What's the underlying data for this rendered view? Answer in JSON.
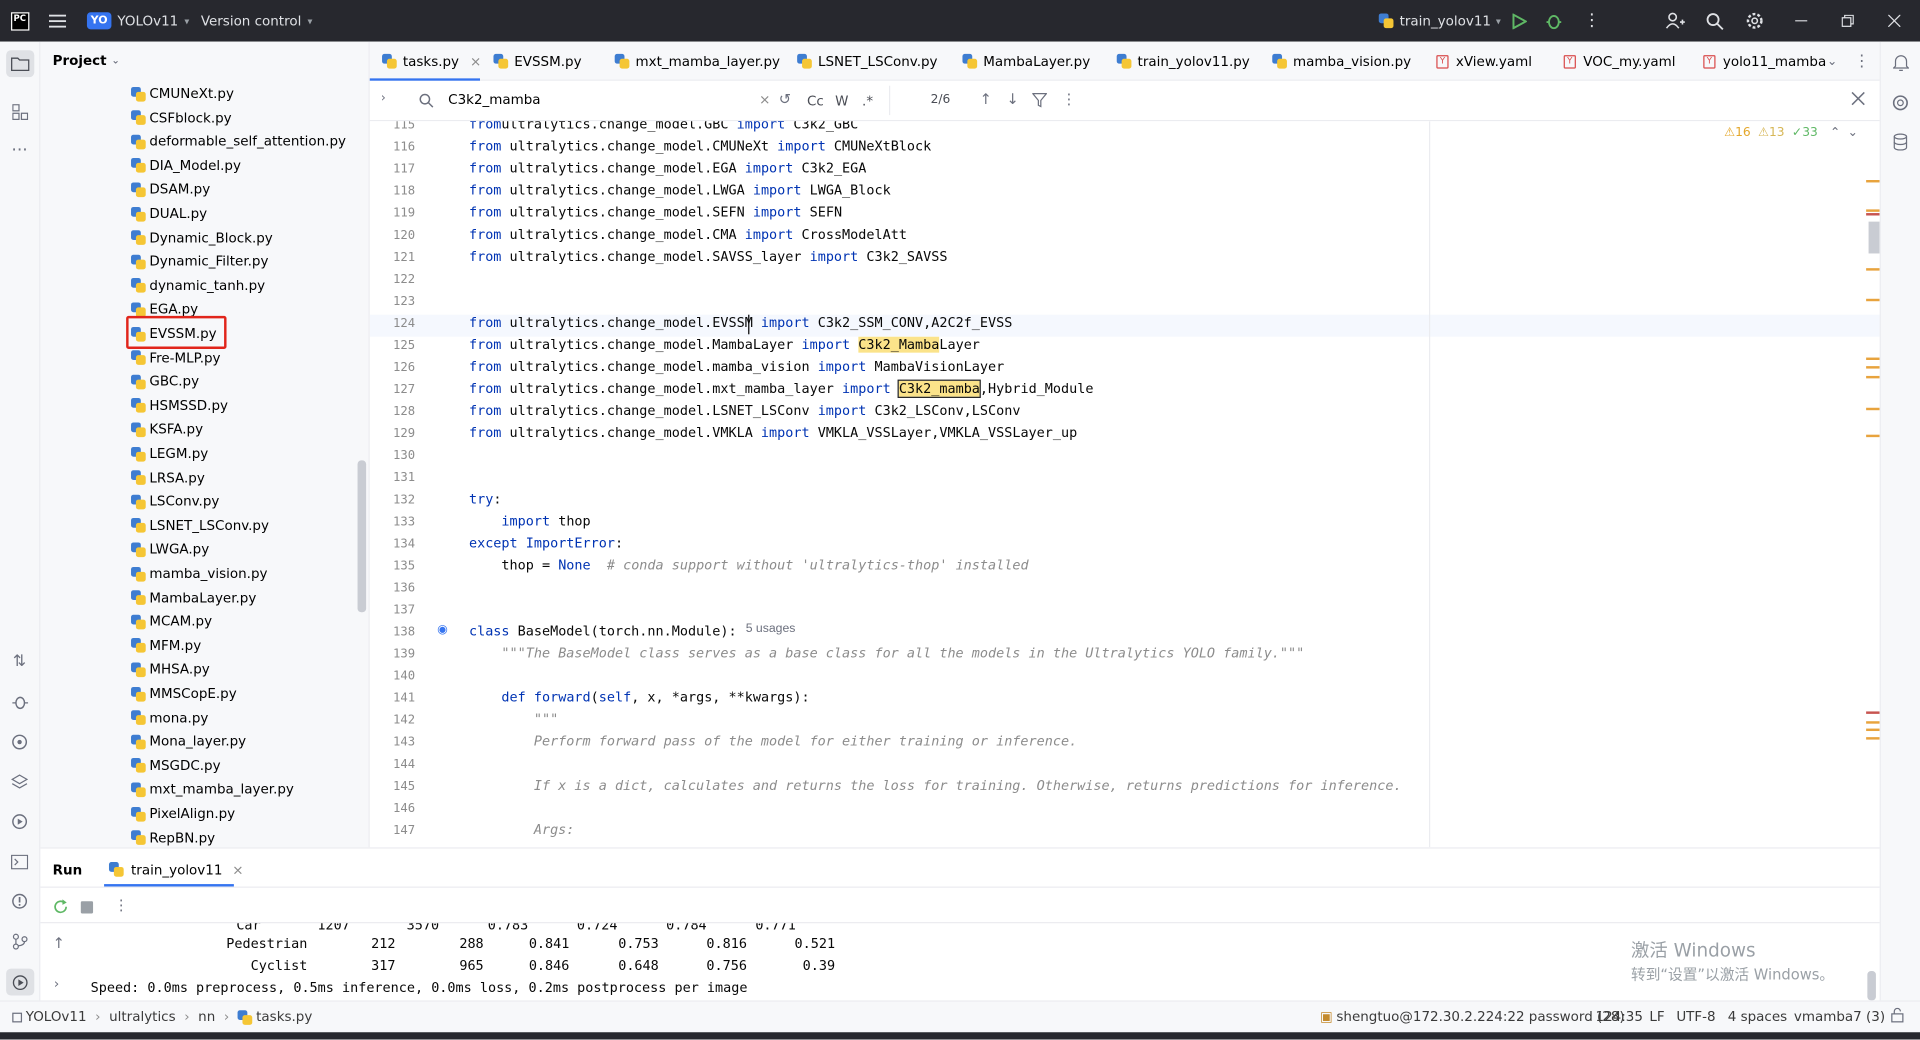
{
  "titlebar": {
    "logo": "PC",
    "project_badge": "YO",
    "project_name": "YOLOv11",
    "vcs_label": "Version control",
    "run_config": "train_yolov11"
  },
  "project_panel": {
    "title": "Project",
    "files": [
      "CMUNeXt.py",
      "CSFblock.py",
      "deformable_self_attention.py",
      "DIA_Model.py",
      "DSAM.py",
      "DUAL.py",
      "Dynamic_Block.py",
      "Dynamic_Filter.py",
      "dynamic_tanh.py",
      "EGA.py",
      "EVSSM.py",
      "Fre-MLP.py",
      "GBC.py",
      "HSMSSD.py",
      "KSFA.py",
      "LEGM.py",
      "LRSA.py",
      "LSConv.py",
      "LSNET_LSConv.py",
      "LWGA.py",
      "mamba_vision.py",
      "MambaLayer.py",
      "MCAM.py",
      "MFM.py",
      "MHSA.py",
      "MMSCopE.py",
      "mona.py",
      "Mona_layer.py",
      "MSGDC.py",
      "mxt_mamba_layer.py",
      "PixelAlign.py",
      "RepBN.py"
    ],
    "highlighted": "EVSSM.py"
  },
  "tabs": [
    {
      "label": "tasks.py",
      "type": "py",
      "active": true,
      "closable": true
    },
    {
      "label": "EVSSM.py",
      "type": "py",
      "active": false,
      "closable": false
    },
    {
      "label": "mxt_mamba_layer.py",
      "type": "py",
      "active": false,
      "closable": false
    },
    {
      "label": "LSNET_LSConv.py",
      "type": "py",
      "active": false,
      "closable": false
    },
    {
      "label": "MambaLayer.py",
      "type": "py",
      "active": false,
      "closable": false
    },
    {
      "label": "train_yolov11.py",
      "type": "py",
      "active": false,
      "closable": false
    },
    {
      "label": "mamba_vision.py",
      "type": "py",
      "active": false,
      "closable": false
    },
    {
      "label": "xView.yaml",
      "type": "yaml",
      "active": false,
      "closable": false
    },
    {
      "label": "VOC_my.yaml",
      "type": "yaml",
      "active": false,
      "closable": false
    },
    {
      "label": "yolo11_mamba",
      "type": "yaml",
      "active": false,
      "closable": false
    }
  ],
  "find": {
    "query": "C3k2_mamba",
    "case_label": "Cc",
    "word_label": "W",
    "regex_label": ".*",
    "match_count": "2/6"
  },
  "inspections": {
    "warnings": "16",
    "weak_warnings": "13",
    "ok": "33"
  },
  "editor": {
    "lines": [
      {
        "n": "115",
        "segs": [
          [
            "kw",
            "from"
          ],
          [
            "",
            "ultralytics.change_model.GBC "
          ],
          [
            "kw",
            "import"
          ],
          [
            "",
            " C3k2_GBC"
          ]
        ]
      },
      {
        "n": "116",
        "segs": [
          [
            "kw",
            "from"
          ],
          [
            "",
            " ultralytics.change_model.CMUNeXt "
          ],
          [
            "kw",
            "import"
          ],
          [
            "",
            " CMUNeXtBlock"
          ]
        ]
      },
      {
        "n": "117",
        "segs": [
          [
            "kw",
            "from"
          ],
          [
            "",
            " ultralytics.change_model.EGA "
          ],
          [
            "kw",
            "import"
          ],
          [
            "",
            " C3k2_EGA"
          ]
        ]
      },
      {
        "n": "118",
        "segs": [
          [
            "kw",
            "from"
          ],
          [
            "",
            " ultralytics.change_model.LWGA "
          ],
          [
            "kw",
            "import"
          ],
          [
            "",
            " LWGA_Block"
          ]
        ]
      },
      {
        "n": "119",
        "segs": [
          [
            "kw",
            "from"
          ],
          [
            "",
            " ultralytics.change_model.SEFN "
          ],
          [
            "kw",
            "import"
          ],
          [
            "",
            " SEFN"
          ]
        ]
      },
      {
        "n": "120",
        "segs": [
          [
            "kw",
            "from"
          ],
          [
            "",
            " ultralytics.change_model.CMA "
          ],
          [
            "kw",
            "import"
          ],
          [
            "",
            " CrossModelAtt"
          ]
        ]
      },
      {
        "n": "121",
        "segs": [
          [
            "kw",
            "from"
          ],
          [
            "",
            " ultralytics.change_model.SAVSS_layer "
          ],
          [
            "kw",
            "import"
          ],
          [
            "",
            " C3k2_SAVSS"
          ]
        ]
      },
      {
        "n": "122",
        "segs": []
      },
      {
        "n": "123",
        "segs": []
      },
      {
        "n": "124",
        "segs": [
          [
            "kw",
            "from"
          ],
          [
            "",
            " ultralytics.change_model.EVSSM "
          ],
          [
            "kw",
            "import"
          ],
          [
            "",
            " C3k2_SSM_CONV,A2C2f_EVSS"
          ]
        ]
      },
      {
        "n": "125",
        "segs": [
          [
            "kw",
            "from"
          ],
          [
            "",
            " ultralytics.change_model.MambaLayer "
          ],
          [
            "kw",
            "import"
          ],
          [
            "",
            " "
          ],
          [
            "hl",
            "C3k2_Mamba"
          ],
          [
            "",
            "Layer"
          ]
        ]
      },
      {
        "n": "126",
        "segs": [
          [
            "kw",
            "from"
          ],
          [
            "",
            " ultralytics.change_model.mamba_vision "
          ],
          [
            "kw",
            "import"
          ],
          [
            "",
            " MambaVisionLayer"
          ]
        ]
      },
      {
        "n": "127",
        "segs": [
          [
            "kw",
            "from"
          ],
          [
            "",
            " ultralytics.change_model.mxt_mamba_layer "
          ],
          [
            "kw",
            "import"
          ],
          [
            "",
            " "
          ],
          [
            "hlb",
            "C3k2_mamba"
          ],
          [
            "",
            ",Hybrid_Module"
          ]
        ]
      },
      {
        "n": "128",
        "segs": [
          [
            "kw",
            "from"
          ],
          [
            "",
            " ultralytics.change_model.LSNET_LSConv "
          ],
          [
            "kw",
            "import"
          ],
          [
            "",
            " C3k2_LSConv,LSConv"
          ]
        ]
      },
      {
        "n": "129",
        "segs": [
          [
            "kw",
            "from"
          ],
          [
            "",
            " ultralytics.change_model.VMKLA "
          ],
          [
            "kw",
            "import"
          ],
          [
            "",
            " VMKLA_VSSLayer,VMKLA_VSSLayer_up"
          ]
        ]
      },
      {
        "n": "130",
        "segs": []
      },
      {
        "n": "131",
        "segs": []
      },
      {
        "n": "132",
        "segs": [
          [
            "kw",
            "try"
          ],
          [
            "",
            ":"
          ]
        ]
      },
      {
        "n": "133",
        "segs": [
          [
            "",
            "    "
          ],
          [
            "kw",
            "import"
          ],
          [
            "",
            " thop"
          ]
        ]
      },
      {
        "n": "134",
        "segs": [
          [
            "kw",
            "except"
          ],
          [
            "",
            " "
          ],
          [
            "kw",
            "ImportError"
          ],
          [
            "",
            ":"
          ]
        ]
      },
      {
        "n": "135",
        "segs": [
          [
            "",
            "    thop = "
          ],
          [
            "kw",
            "None"
          ],
          [
            "",
            "  "
          ],
          [
            "cm",
            "# conda support without 'ultralytics-thop' installed"
          ]
        ]
      },
      {
        "n": "136",
        "segs": []
      },
      {
        "n": "137",
        "segs": []
      },
      {
        "n": "138",
        "segs": [
          [
            "kw",
            "class"
          ],
          [
            "",
            " BaseModel(torch.nn.Module):"
          ]
        ]
      },
      {
        "n": "139",
        "segs": [
          [
            "",
            "    "
          ],
          [
            "doc",
            "\"\"\"The BaseModel class serves as a base class for all the models in the Ultralytics YOLO family.\"\"\""
          ]
        ]
      },
      {
        "n": "140",
        "segs": []
      },
      {
        "n": "141",
        "segs": [
          [
            "",
            "    "
          ],
          [
            "kw",
            "def"
          ],
          [
            "",
            " "
          ],
          [
            "kw",
            "forward"
          ],
          [
            "",
            "("
          ],
          [
            "kw",
            "self"
          ],
          [
            "",
            ", x, *args, **kwargs):"
          ]
        ]
      },
      {
        "n": "142",
        "segs": [
          [
            "",
            "        "
          ],
          [
            "doc",
            "\"\"\""
          ]
        ]
      },
      {
        "n": "143",
        "segs": [
          [
            "",
            "        "
          ],
          [
            "doc",
            "Perform forward pass of the model for either training or inference."
          ]
        ]
      },
      {
        "n": "144",
        "segs": []
      },
      {
        "n": "145",
        "segs": [
          [
            "",
            "        "
          ],
          [
            "doc",
            "If x is a dict, calculates and returns the loss for training. Otherwise, returns predictions for inference."
          ]
        ]
      },
      {
        "n": "146",
        "segs": []
      },
      {
        "n": "147",
        "segs": [
          [
            "",
            "        "
          ],
          [
            "doc",
            "Args:"
          ]
        ]
      }
    ],
    "usages_hint": "5 usages"
  },
  "run_panel": {
    "title": "Run",
    "tab_label": "train_yolov11",
    "rows": [
      [
        "Pedestrian",
        "212",
        "288",
        "0.841",
        "0.753",
        "0.816",
        "0.521"
      ],
      [
        "Cyclist",
        "317",
        "965",
        "0.846",
        "0.648",
        "0.756",
        "0.39"
      ]
    ],
    "speed_line": "Speed: 0.0ms preprocess, 0.5ms inference, 0.0ms loss, 0.2ms postprocess per image"
  },
  "watermark": {
    "line1": "激活 Windows",
    "line2": "转到“设置”以激活 Windows。"
  },
  "statusbar": {
    "breadcrumbs": [
      "YOLOv11",
      "ultralytics",
      "nn",
      "tasks.py"
    ],
    "interpreter": "shengtuo@172.30.2.224:22 password (28)",
    "position": "124:35",
    "line_sep": "LF",
    "encoding": "UTF-8",
    "indent": "4 spaces",
    "env": "vmamba7 (3)"
  }
}
